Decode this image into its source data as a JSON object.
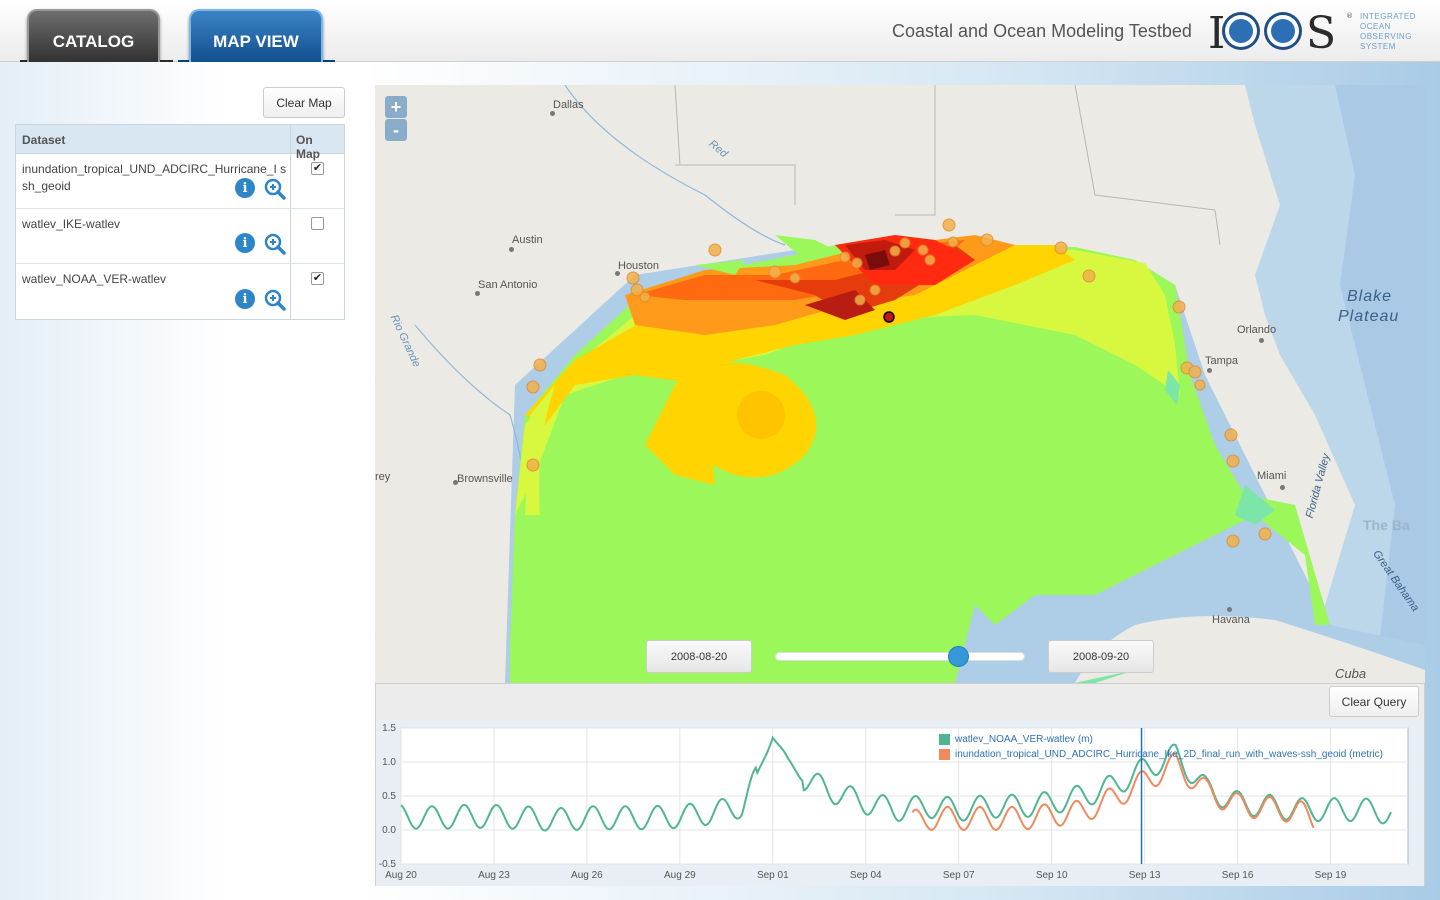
{
  "header": {
    "tabs": [
      {
        "label": "CATALOG",
        "active": false
      },
      {
        "label": "MAP VIEW",
        "active": true
      }
    ],
    "site_title": "Coastal and Ocean Modeling Testbed",
    "logo_text": [
      "INTEGRATED",
      "OCEAN",
      "OBSERVING",
      "SYSTEM"
    ],
    "logo_mark": "IOOS"
  },
  "sidebar": {
    "clear_map_label": "Clear Map",
    "table": {
      "col_dataset": "Dataset",
      "col_on_map": "On Map",
      "rows": [
        {
          "name": "inundation_tropical_UND_ADCIRC_Hurricane_Ike_2D_final_run_with_waves-ssh_geoid",
          "display": "inundation_tropical_UND_ADCIRC_Hurricane_I ssh_geoid",
          "on_map": true
        },
        {
          "name": "watlev_IKE-watlev",
          "display": "watlev_IKE-watlev",
          "on_map": false
        },
        {
          "name": "watlev_NOAA_VER-watlev",
          "display": "watlev_NOAA_VER-watlev",
          "on_map": true
        }
      ]
    }
  },
  "map": {
    "zoom_in": "+",
    "zoom_out": "-",
    "labels": {
      "dallas": "Dallas",
      "red": "Red",
      "austin": "Austin",
      "houston": "Houston",
      "san_antonio": "San Antonio",
      "rio_grande": "Rio Grande",
      "brownsville": "Brownsville",
      "rey": "rey",
      "orlando": "Orlando",
      "tampa": "Tampa",
      "miami": "Miami",
      "havana": "Havana",
      "cuba": "Cuba",
      "blake_plateau_1": "Blake",
      "blake_plateau_2": "Plateau",
      "florida_valley": "Florida Valley",
      "the_bahamas": "The Ba",
      "great_bahama": "Great Bahama"
    },
    "time_start": "2008-08-20",
    "time_end": "2008-09-20",
    "slider_position": 0.74
  },
  "query": {
    "clear_query_label": "Clear Query"
  },
  "chart_data": {
    "type": "line",
    "ylim": [
      -0.5,
      1.5
    ],
    "yticks": [
      "1.5",
      "1.0",
      "0.5",
      "0.0",
      "-0.5"
    ],
    "xticks": [
      "Aug 20",
      "Aug 23",
      "Aug 26",
      "Aug 29",
      "Sep 01",
      "Sep 04",
      "Sep 07",
      "Sep 10",
      "Sep 13",
      "Sep 16",
      "Sep 19"
    ],
    "x_unit_note": "days from Aug 20 2008",
    "series": [
      {
        "name": "watlev_NOAA_VER-watlev (m)",
        "color": "#4fb595",
        "x": [
          0,
          1,
          2,
          3,
          4,
          5,
          6,
          7,
          8,
          9,
          10,
          11,
          11.5,
          12,
          12.5,
          13,
          14,
          15,
          16,
          17,
          18,
          19,
          20,
          21,
          22,
          23,
          24,
          25,
          26,
          27,
          28,
          29,
          30,
          31,
          32
        ],
        "y": [
          0.2,
          0.18,
          0.2,
          0.2,
          0.18,
          0.15,
          0.18,
          0.18,
          0.18,
          0.2,
          0.25,
          0.35,
          0.8,
          1.4,
          1.0,
          0.75,
          0.55,
          0.4,
          0.3,
          0.35,
          0.3,
          0.35,
          0.35,
          0.4,
          0.5,
          0.65,
          0.9,
          1.1,
          0.6,
          0.4,
          0.35,
          0.3,
          0.3,
          0.3,
          0.25
        ]
      },
      {
        "name": "inundation_tropical_UND_ADCIRC_Hurricane_Ike_2D_final_run_with_waves-ssh_geoid (metric)",
        "color": "#f08a5d",
        "x": [
          16.5,
          17,
          18,
          19,
          20,
          21,
          22,
          23,
          24,
          25,
          26,
          27,
          28,
          29,
          29.5
        ],
        "y": [
          0.15,
          0.2,
          0.2,
          0.2,
          0.2,
          0.25,
          0.3,
          0.5,
          0.75,
          1.0,
          0.6,
          0.4,
          0.35,
          0.3,
          0.15
        ]
      }
    ],
    "cursor_x": 23.9
  }
}
